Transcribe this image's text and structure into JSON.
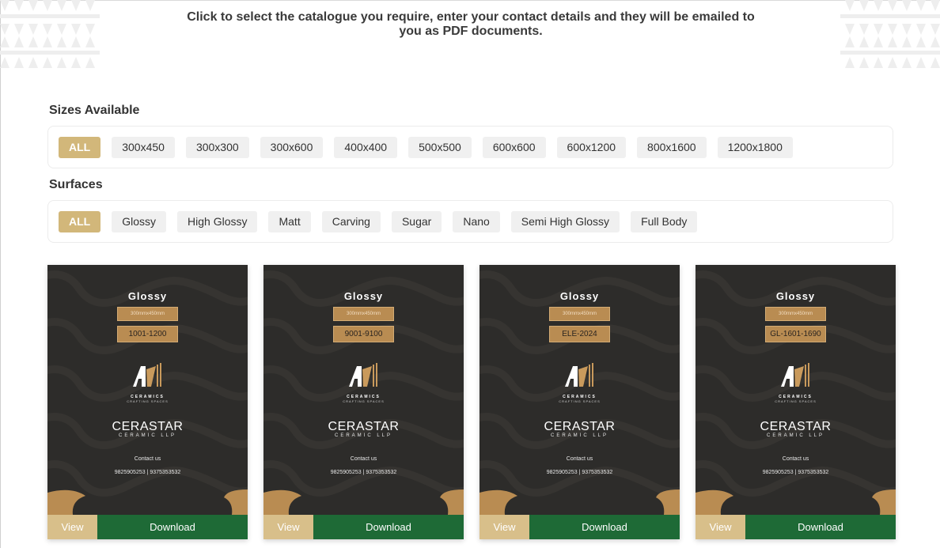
{
  "intro": {
    "line1": "Click to select the catalogue you require, enter your contact details and they will be emailed to",
    "line2": "you as PDF documents."
  },
  "sizes": {
    "title": "Sizes Available",
    "options": [
      "ALL",
      "300x450",
      "300x300",
      "300x600",
      "400x400",
      "500x500",
      "600x600",
      "600x1200",
      "800x1600",
      "1200x1800"
    ],
    "selected": "ALL"
  },
  "surfaces": {
    "title": "Surfaces",
    "options": [
      "ALL",
      "Glossy",
      "High Glossy",
      "Matt",
      "Carving",
      "Sugar",
      "Nano",
      "Semi High Glossy",
      "Full Body"
    ],
    "selected": "ALL"
  },
  "catalogues": [
    {
      "title": "Glossy",
      "size": "300mmx450mm",
      "code": "1001-1200"
    },
    {
      "title": "Glossy",
      "size": "300mmx450mm",
      "code": "9001-9100"
    },
    {
      "title": "Glossy",
      "size": "300mmx450mm",
      "code": "ELE-2024"
    },
    {
      "title": "Glossy",
      "size": "300mmx450mm",
      "code": "GL-1601-1690"
    }
  ],
  "cover_common": {
    "ceramics": "CERAMICS",
    "tagline": "CRAFTING SPACES",
    "brand": "CERASTAR",
    "brand_sub": "CERAMIC LLP",
    "contact_label": "Contact us",
    "phones": "9825905253 | 9375353532"
  },
  "buttons": {
    "view": "View",
    "download": "Download"
  },
  "colors": {
    "active_chip": "#d2b77a",
    "chip_bg": "#f0f0f0",
    "cover_bg": "#2d2c2a",
    "gold": "#b98c52",
    "view_button": "#d8bf8a",
    "download_button": "#1e6a36"
  }
}
